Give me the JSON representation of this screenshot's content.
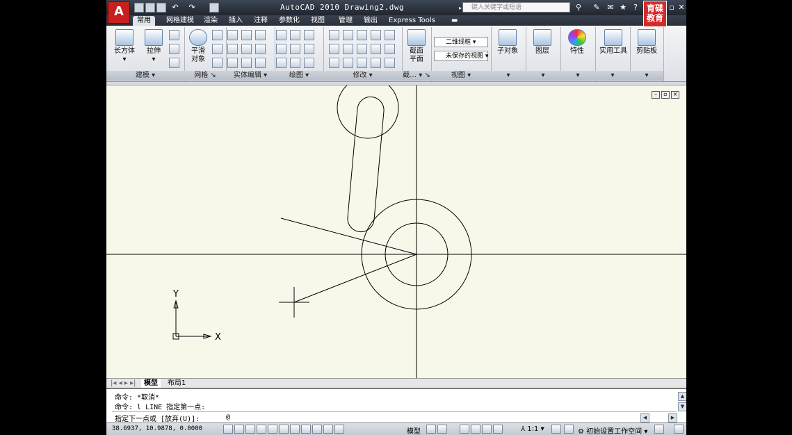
{
  "app": {
    "logo_letter": "A",
    "title": "AutoCAD 2010  Drawing2.dwg",
    "search_placeholder": "键入关键字或短语",
    "brand_line1": "育碟",
    "brand_line2": "教育"
  },
  "tabs": [
    "常用",
    "网格建模",
    "渲染",
    "插入",
    "注释",
    "参数化",
    "视图",
    "管理",
    "输出",
    "Express Tools"
  ],
  "ribbon": {
    "panels": {
      "modeling": "建模",
      "mesh": "网格",
      "solid_edit": "实体编辑",
      "draw": "绘图",
      "modify": "修改",
      "section": "截…",
      "view": "视图"
    },
    "buttons": {
      "box": "长方体",
      "extrude": "拉伸",
      "smooth_line1": "平滑",
      "smooth_line2": "对象",
      "section_line1": "截面",
      "section_line2": "平面",
      "subobject": "子对象",
      "layers": "图层",
      "properties": "特性",
      "utilities": "实用工具",
      "clipboard": "剪贴板"
    },
    "visual_style": "二维线框",
    "saved_view": "未保存的视图"
  },
  "layout_tabs": [
    "模型",
    "布局1"
  ],
  "command": {
    "history": [
      "命令: *取消*",
      "命令: l LINE 指定第一点:"
    ],
    "prompt": "指定下一点或 [放弃(U)]:",
    "value": "@"
  },
  "status": {
    "coords": "38.6937, 10.9878, 0.0000",
    "space": "模型",
    "scale": "1:1",
    "workspace": "初始设置工作空间"
  },
  "ucs": {
    "x_label": "X",
    "y_label": "Y"
  },
  "colors": {
    "canvas": "#f7f7ea",
    "linework": "#000000",
    "brand": "#d12c2c"
  }
}
